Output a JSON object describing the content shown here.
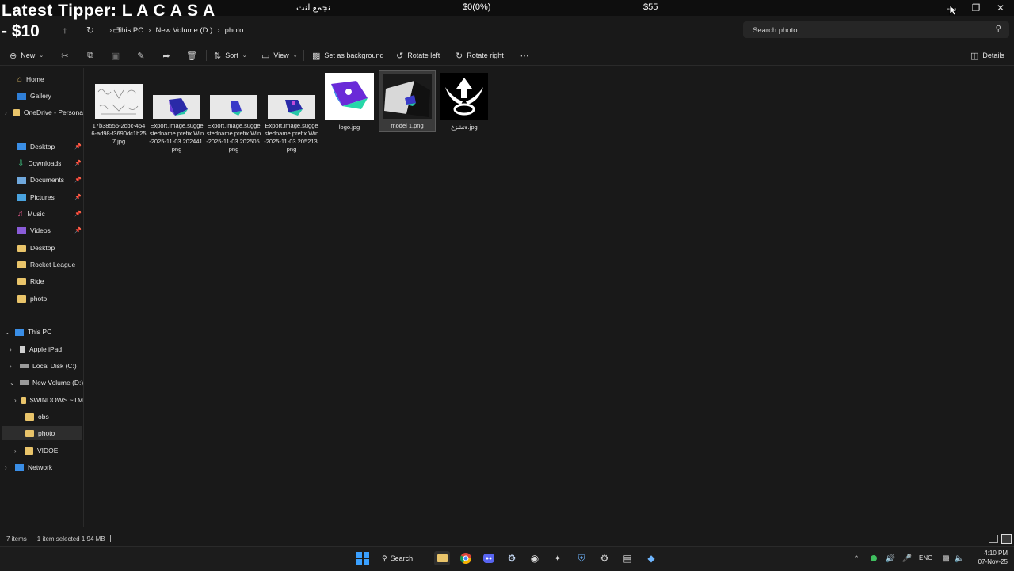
{
  "overlay": {
    "tipper_label": "Latest Tipper: L A C A S A",
    "tipper_amount": "- $10",
    "arabic_text": "نجمع لنت",
    "goal": "$0(0%)",
    "amount_right": "$55"
  },
  "window": {
    "minimize_icon": "minimize-icon",
    "maximize_icon": "maximize-icon",
    "close_icon": "close-icon"
  },
  "breadcrumb": [
    "This PC",
    "New Volume (D:)",
    "photo"
  ],
  "search": {
    "placeholder": "Search photo"
  },
  "toolbar": {
    "new": "New",
    "sort": "Sort",
    "view": "View",
    "set_background": "Set as background",
    "rotate_left": "Rotate left",
    "rotate_right": "Rotate right",
    "details": "Details"
  },
  "sidebar": {
    "home": "Home",
    "gallery": "Gallery",
    "onedrive": "OneDrive - Persona",
    "desktop": "Desktop",
    "downloads": "Downloads",
    "documents": "Documents",
    "pictures": "Pictures",
    "music": "Music",
    "videos": "Videos",
    "desktop2": "Desktop",
    "rocket": "Rocket League",
    "ride": "Ride",
    "photo": "photo",
    "thispc": "This PC",
    "ipad": "Apple iPad",
    "localc": "Local Disk (C:)",
    "newvol": "New Volume (D:)",
    "windows": "$WINDOWS.~TM",
    "obs": "obs",
    "photo2": "photo",
    "vidoe": "VIDOE",
    "network": "Network"
  },
  "files": [
    "17b38555-2cbc-4546-ad98-f3690dc1b257.jpg",
    "Export.Image.suggestedname.prefix.Win-2025-11-03 202441.png",
    "Export.Image.suggestedname.prefix.Win-2025-11-03 202505.png",
    "Export.Image.suggestedname.prefix.Win-2025-11-03 205213.png",
    "logo.jpg",
    "model 1.png",
    "ةتشزغ.jpg"
  ],
  "status": {
    "count": "7 items",
    "selection": "1 item selected  1.94 MB"
  },
  "taskbar": {
    "search": "Search",
    "lang": "ENG",
    "time": "4:10 PM",
    "date": "07-Nov-25"
  }
}
